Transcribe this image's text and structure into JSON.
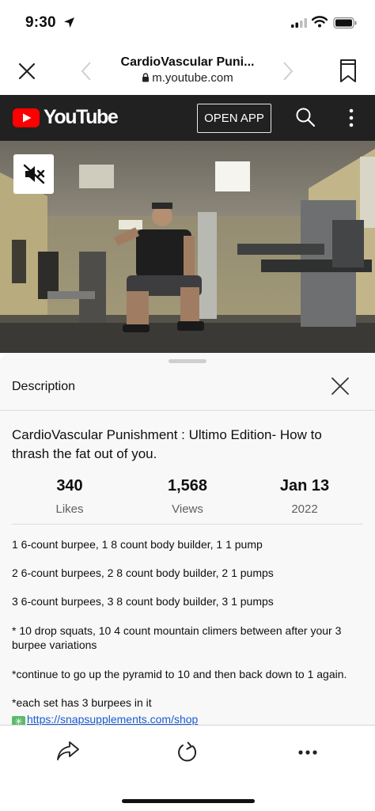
{
  "status_bar": {
    "time": "9:30"
  },
  "browser": {
    "page_title": "CardioVascular Puni...",
    "url": "m.youtube.com"
  },
  "youtube_header": {
    "logo_text": "YouTube",
    "open_app_label": "OPEN APP"
  },
  "description_panel": {
    "heading": "Description",
    "video_title": "CardioVascular Punishment : Ultimo Edition- How to thrash the fat out of you.",
    "stats": [
      {
        "value": "340",
        "label": "Likes"
      },
      {
        "value": "1,568",
        "label": "Views"
      },
      {
        "value": "Jan 13",
        "label": "2022"
      }
    ],
    "lines": [
      "1 6-count burpee, 1 8 count body builder, 1 1 pump",
      "2 6-count burpees, 2 8 count body builder, 2 1 pumps",
      "3 6-count burpees, 3 8 count body builder, 3 1 pumps",
      "* 10 drop squats, 10 4 count mountain climers between after your 3 burpee variations",
      "*continue to go up the pyramid to 10 and then back down to 1 again.",
      "*each set has 3 burpees in it"
    ],
    "link_text": "https://snapsupplements.com/shop"
  },
  "colors": {
    "youtube_red": "#ff0000",
    "header_bg": "#212121",
    "link": "#1a5bd3"
  }
}
